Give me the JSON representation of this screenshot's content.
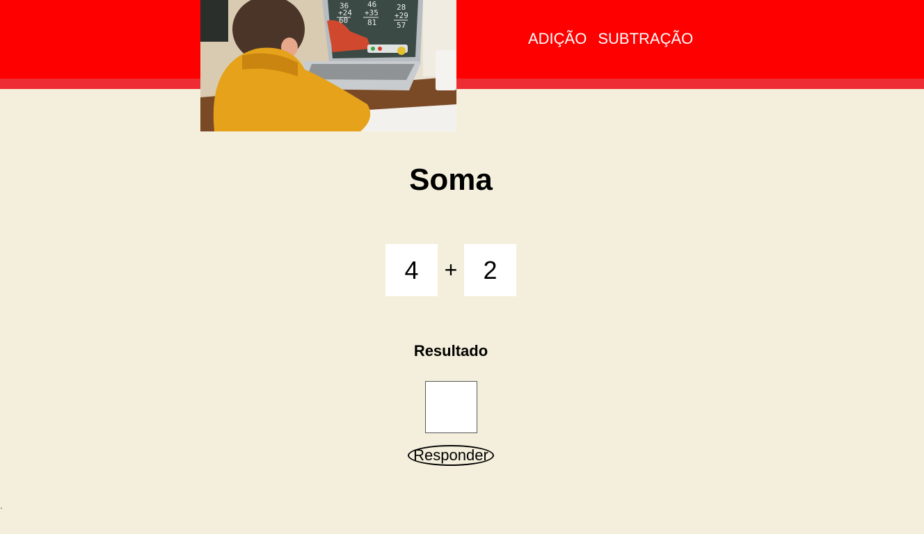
{
  "header": {
    "nav": [
      {
        "label": "ADIÇÃO"
      },
      {
        "label": "SUBTRAÇÃO"
      }
    ],
    "hero_image": "child-at-laptop-online-math-class-image",
    "colors": {
      "bar": "#ff0000",
      "stripe": "#ee2c34"
    }
  },
  "main": {
    "title": "Soma",
    "operand_a": "4",
    "operator": "+",
    "operand_b": "2",
    "result_label": "Resultado",
    "answer_value": "",
    "respond_label": "Responder"
  },
  "page": {
    "background": "#f4efdc",
    "corner_mark": "`"
  }
}
